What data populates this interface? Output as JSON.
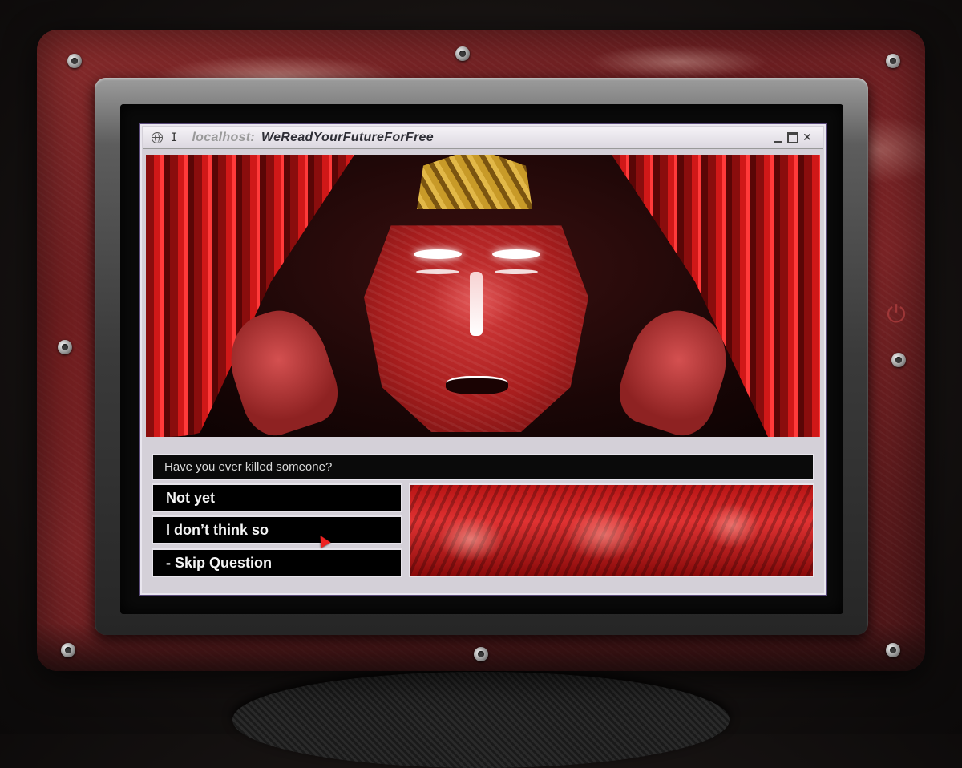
{
  "window": {
    "host_label": "localhost:",
    "title": "WeReadYourFutureForFree",
    "separator": "I"
  },
  "question": {
    "text": "Have you ever killed someone?"
  },
  "answers": [
    {
      "label": "Not yet"
    },
    {
      "label": "I don’t think so"
    },
    {
      "label": "- Skip Question"
    }
  ],
  "icons": {
    "window": "globe-icon",
    "minimize": "minimize-icon",
    "maximize": "maximize-icon",
    "close": "close-icon",
    "power": "power-icon",
    "cursor": "cursor-arrow-icon"
  },
  "colors": {
    "accent_red": "#d01818",
    "window_frame": "#5a4a7a",
    "answer_bg": "#000000",
    "answer_text": "#f4f4f4"
  }
}
